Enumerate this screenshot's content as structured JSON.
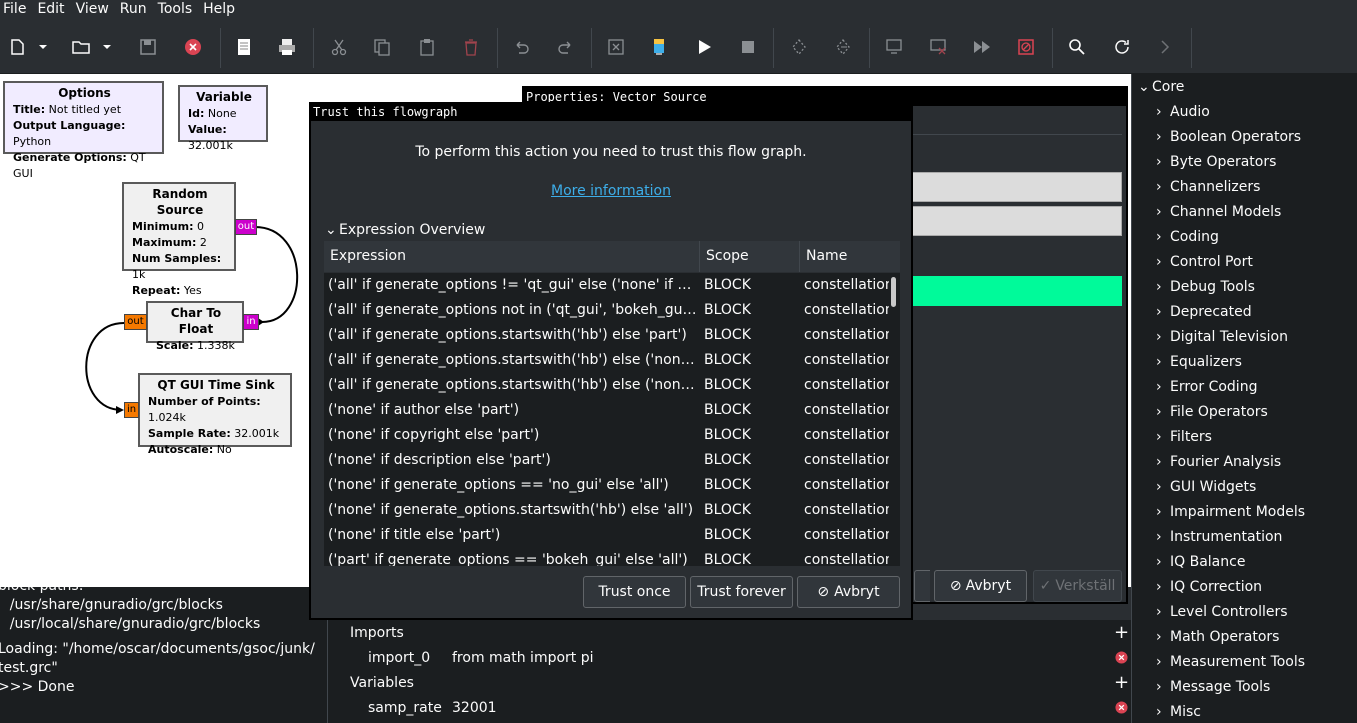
{
  "menu": [
    "File",
    "Edit",
    "View",
    "Run",
    "Tools",
    "Help"
  ],
  "canvas": {
    "options": {
      "title": "Options",
      "rows": [
        {
          "k": "Title:",
          "v": "Not titled yet"
        },
        {
          "k": "Output Language:",
          "v": "Python"
        },
        {
          "k": "Generate Options:",
          "v": "QT GUI"
        }
      ]
    },
    "variable": {
      "title": "Variable",
      "rows": [
        {
          "k": "Id:",
          "v": "None"
        },
        {
          "k": "Value:",
          "v": "32.001k"
        }
      ]
    },
    "random_source": {
      "title": "Random Source",
      "rows": [
        {
          "k": "Minimum:",
          "v": "0"
        },
        {
          "k": "Maximum:",
          "v": "2"
        },
        {
          "k": "Num Samples:",
          "v": "1k"
        },
        {
          "k": "Repeat:",
          "v": "Yes"
        }
      ],
      "port_out": "out"
    },
    "char_to_float": {
      "title": "Char To Float",
      "rows": [
        {
          "k": "Scale:",
          "v": "1.338k"
        }
      ],
      "port_in": "in",
      "port_out": "out"
    },
    "time_sink": {
      "title": "QT GUI Time Sink",
      "rows": [
        {
          "k": "Number of Points:",
          "v": "1.024k"
        },
        {
          "k": "Sample Rate:",
          "v": "32.001k"
        },
        {
          "k": "Autoscale:",
          "v": "No"
        }
      ],
      "port_in": "in"
    }
  },
  "console": {
    "lines": [
      "block paths:",
      "    /usr/share/gnuradio/grc/blocks",
      "    /usr/local/share/gnuradio/grc/blocks",
      "",
      "Loading: \"/home/oscar/documents/gsoc/junk/",
      "test.grc\"",
      ">>> Done"
    ]
  },
  "vars": {
    "imports_label": "Imports",
    "import_name": "import_0",
    "import_value": "from math import pi",
    "variables_label": "Variables",
    "var_name": "samp_rate",
    "var_value": "32001"
  },
  "properties": {
    "title": "Properties: Vector Source",
    "cancel": "Avbryt",
    "apply": "Verkställ"
  },
  "trust": {
    "title": "Trust this flowgraph",
    "message": "To perform this action you need to trust this flow graph.",
    "more_info": "More information",
    "overview_label": "Expression Overview",
    "col_expression": "Expression",
    "col_scope": "Scope",
    "col_name": "Name",
    "rows": [
      {
        "expr": "('all' if generate_options != 'qt_gui' else ('none' if qt_qss_th...",
        "scope": "BLOCK",
        "name": "constellation"
      },
      {
        "expr": "('all' if generate_options not in ('qt_gui', 'bokeh_gui') else ('...",
        "scope": "BLOCK",
        "name": "constellation"
      },
      {
        "expr": "('all' if generate_options.startswith('hb') else 'part')",
        "scope": "BLOCK",
        "name": "constellation"
      },
      {
        "expr": "('all' if generate_options.startswith('hb') else ('none' if max...",
        "scope": "BLOCK",
        "name": "constellation"
      },
      {
        "expr": "('all' if generate_options.startswith('hb') else ('none' if realti...",
        "scope": "BLOCK",
        "name": "constellation"
      },
      {
        "expr": "('none' if author else 'part')",
        "scope": "BLOCK",
        "name": "constellation"
      },
      {
        "expr": "('none' if copyright else 'part')",
        "scope": "BLOCK",
        "name": "constellation"
      },
      {
        "expr": "('none' if description else 'part')",
        "scope": "BLOCK",
        "name": "constellation"
      },
      {
        "expr": "('none' if generate_options == 'no_gui' else 'all')",
        "scope": "BLOCK",
        "name": "constellation"
      },
      {
        "expr": "('none' if generate_options.startswith('hb') else 'all')",
        "scope": "BLOCK",
        "name": "constellation"
      },
      {
        "expr": "('none' if title else 'part')",
        "scope": "BLOCK",
        "name": "constellation"
      },
      {
        "expr": "('part' if generate_options == 'bokeh_gui' else 'all')",
        "scope": "BLOCK",
        "name": "constellation"
      }
    ],
    "btn_once": "Trust once",
    "btn_forever": "Trust forever",
    "btn_cancel": "Avbryt"
  },
  "tree": {
    "root": "Core",
    "items": [
      "Audio",
      "Boolean Operators",
      "Byte Operators",
      "Channelizers",
      "Channel Models",
      "Coding",
      "Control Port",
      "Debug Tools",
      "Deprecated",
      "Digital Television",
      "Equalizers",
      "Error Coding",
      "File Operators",
      "Filters",
      "Fourier Analysis",
      "GUI Widgets",
      "Impairment Models",
      "Instrumentation",
      "IQ Balance",
      "IQ Correction",
      "Level Controllers",
      "Math Operators",
      "Measurement Tools",
      "Message Tools",
      "Misc"
    ]
  },
  "colors": {
    "accent_link": "#3daee9",
    "highlight_green": "#00fa9a",
    "close_red": "#da4453",
    "port_magenta": "#cc00cc",
    "port_orange": "#f57900"
  }
}
